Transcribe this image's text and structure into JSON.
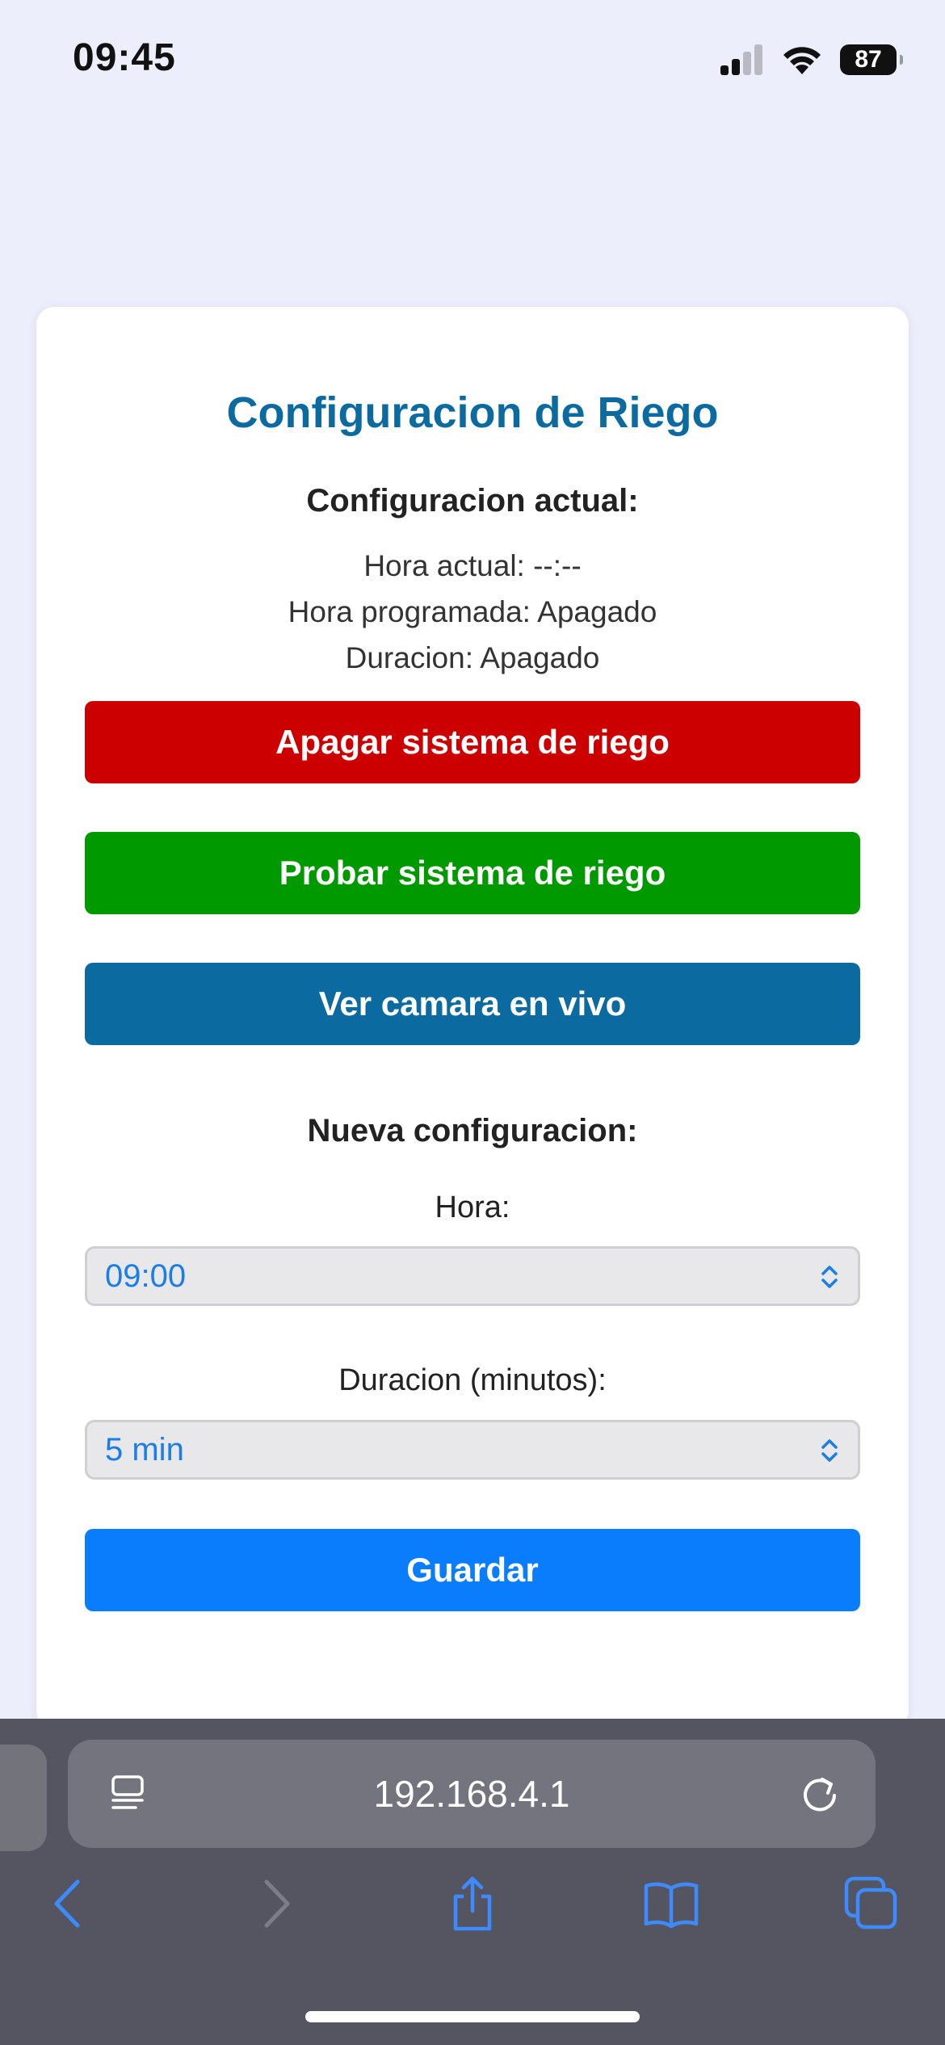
{
  "status_bar": {
    "time": "09:45",
    "battery": "87"
  },
  "card": {
    "title": "Configuracion de Riego",
    "current_config": {
      "heading": "Configuracion actual:",
      "current_time": "Hora actual: --:--",
      "scheduled_time": "Hora programada: Apagado",
      "duration": "Duracion: Apagado"
    },
    "buttons": {
      "turn_off": "Apagar sistema de riego",
      "test": "Probar sistema de riego",
      "camera": "Ver camara en vivo",
      "save": "Guardar"
    },
    "new_config": {
      "heading": "Nueva configuracion:",
      "hour_label": "Hora:",
      "hour_value": "09:00",
      "duration_label": "Duracion (minutos):",
      "duration_value": "5 min"
    }
  },
  "browser": {
    "url": "192.168.4.1"
  },
  "colors": {
    "title": "#0b6a9f",
    "turn_off_button": "#cc0000",
    "test_button": "#009900",
    "camera_button": "#0b6a9f",
    "save_button": "#0a7dfd",
    "select_text": "#1b7ee6",
    "ios_blue": "#3d8bff"
  }
}
